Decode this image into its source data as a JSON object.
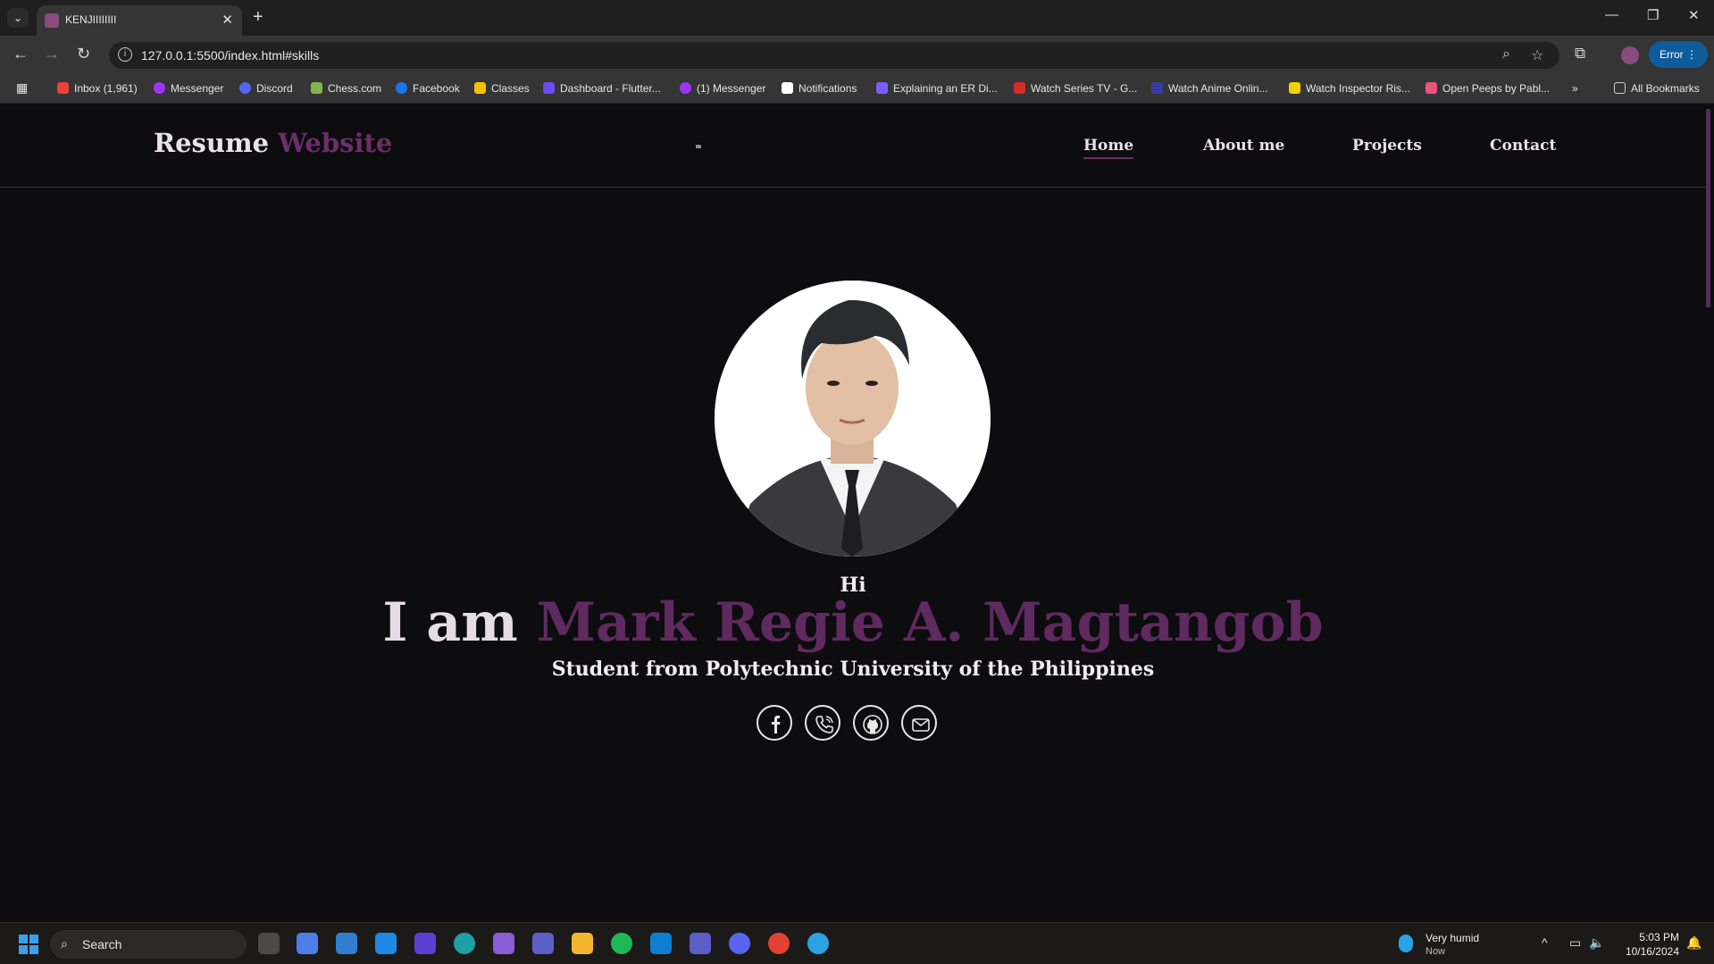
{
  "browser": {
    "tab_title": "KENJIIIIIIII",
    "url": "127.0.0.1:5500/index.html#skills",
    "error_label": "Error",
    "bookmarks": [
      {
        "label": "Inbox (1,961)",
        "color": "#ea4335"
      },
      {
        "label": "Messenger",
        "color": "#a033ff"
      },
      {
        "label": "Discord",
        "color": "#5865f2"
      },
      {
        "label": "Chess.com",
        "color": "#81b64c"
      },
      {
        "label": "Facebook",
        "color": "#1877f2"
      },
      {
        "label": "Classes",
        "color": "#f2c200"
      },
      {
        "label": "Dashboard - Flutter...",
        "color": "#6a4cf5"
      },
      {
        "label": "(1) Messenger",
        "color": "#a033ff"
      },
      {
        "label": "Notifications",
        "color": "#ffffff"
      },
      {
        "label": "Explaining an ER Di...",
        "color": "#7c5cff"
      },
      {
        "label": "Watch Series TV - G...",
        "color": "#d62b2b"
      },
      {
        "label": "Watch Anime Onlin...",
        "color": "#3a3aa0"
      },
      {
        "label": "Watch Inspector Ris...",
        "color": "#f5d000"
      },
      {
        "label": "Open Peeps by Pabl...",
        "color": "#e8547a"
      }
    ],
    "all_bookmarks_label": "All Bookmarks"
  },
  "site": {
    "logo_main": "Resume",
    "logo_accent": "Website",
    "nav": [
      "Home",
      "About me",
      "Projects",
      "Contact"
    ],
    "greeting": "Hi",
    "intro": "I am",
    "name": "Mark Regie A. Magtangob",
    "subtitle": "Student from Polytechnic University of the Philippines",
    "accent_color": "#5e2a5f",
    "socials": [
      "facebook-icon",
      "phone-icon",
      "github-icon",
      "email-icon"
    ]
  },
  "taskbar": {
    "search_label": "Search",
    "weather_main": "Very humid",
    "weather_sub": "Now",
    "time": "5:03 PM",
    "date": "10/16/2024"
  }
}
